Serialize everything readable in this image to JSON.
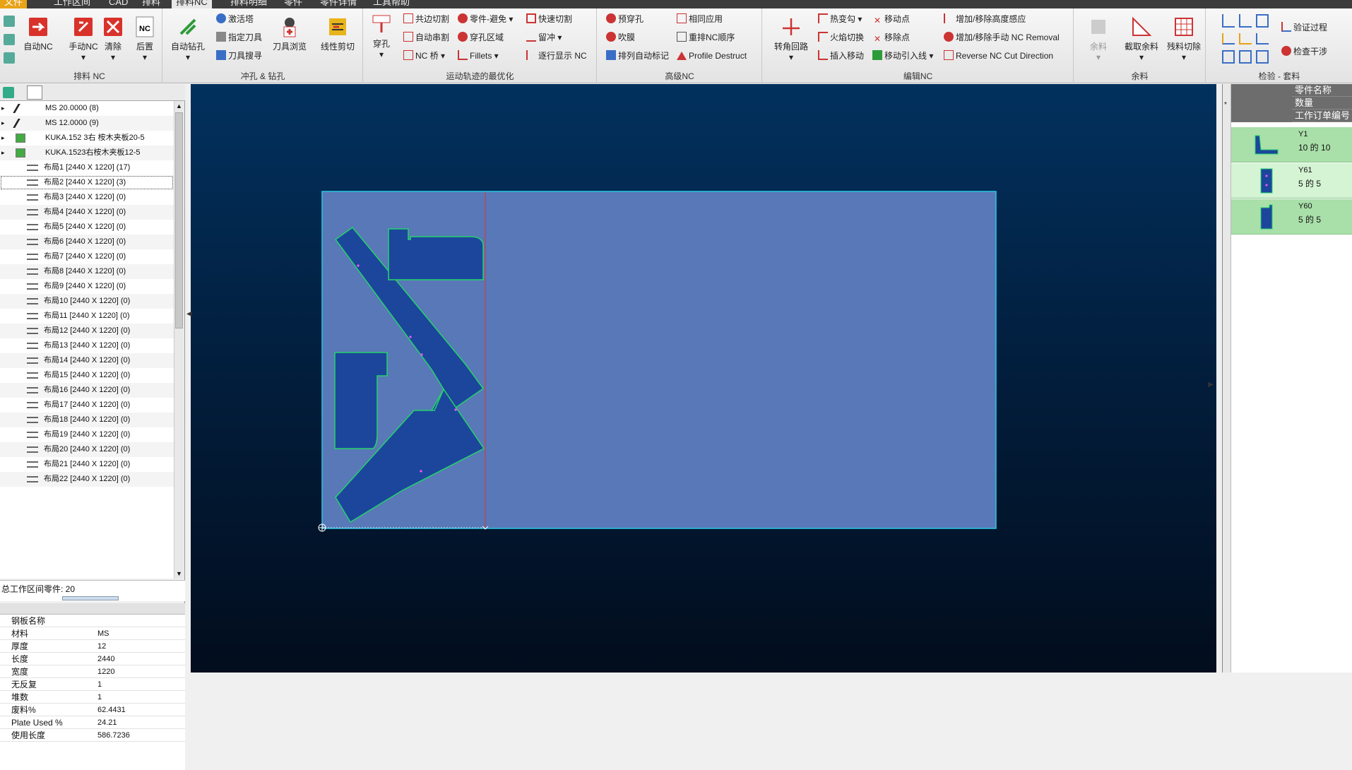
{
  "menu_tabs": [
    "文件",
    "工作区间",
    "CAD",
    "排料",
    "排料NC",
    "排料明细",
    "零件",
    "零件详情",
    "工具帮助"
  ],
  "ribbon": {
    "g1": {
      "label": "排料 NC",
      "auto_nc": "自动NC",
      "manual_nc": "手动NC",
      "clear": "清除",
      "post": "后置"
    },
    "g2": {
      "label": "冲孔 & 钻孔",
      "auto_drill": "自动钻孔",
      "activate": "激活塔",
      "set_tool": "指定刀具",
      "tool_search": "刀具搜寻",
      "tool_browse": "刀具浏览",
      "line_shear": "线性剪切"
    },
    "g3": {
      "label": "运动轨迹的最优化",
      "pierce": "穿孔",
      "common_cut": "共边切割",
      "auto_chain": "自动串割",
      "nc_bridge": "NC 桥",
      "part_avoid": "零件-避免",
      "pierce_area": "穿孔区域",
      "fillets": "Fillets",
      "quick_cut": "快速切割",
      "micro_joint": "留冲",
      "step_show": "逐行显示 NC"
    },
    "g4": {
      "label": "高级NC",
      "prepierce": "预穿孔",
      "blow": "吹膜",
      "auto_mark": "排列自动标记",
      "apply_same": "相同应用",
      "reorder": "重排NC顺序",
      "profile_destruct": "Profile Destruct"
    },
    "g5": {
      "label": "编辑NC",
      "corner_loop": "转角回路",
      "thermal": "热变勾",
      "flame": "火焰切换",
      "insert_move": "插入移动",
      "move_pt": "移动点",
      "remove_pt": "移除点",
      "move_lead": "移动引入线",
      "height_sense": "增加/移除高度感应",
      "manual_removal": "增加/移除手动 NC Removal",
      "reverse_dir": "Reverse NC Cut Direction"
    },
    "g6": {
      "label": "余料",
      "remnant": "余料",
      "cut_remnant": "截取余料",
      "scrap_cut": "残料切除"
    },
    "g7": {
      "label": "检验 - 套料",
      "verify": "验证过程",
      "check": "检查干涉"
    }
  },
  "tree": [
    {
      "label": "MS 20.0000 (8)",
      "lvl": 0
    },
    {
      "label": "MS 12.0000 (9)",
      "lvl": 0
    },
    {
      "label": "KUKA.152 3右 桉木夹板20-5",
      "lvl": 0
    },
    {
      "label": "KUKA.1523右桉木夹板12-5",
      "lvl": 0
    },
    {
      "label": "布局1 [2440 X 1220]  (17)",
      "lvl": 1
    },
    {
      "label": "布局2 [2440 X 1220]  (3)",
      "lvl": 1,
      "sel": true
    },
    {
      "label": "布局3 [2440 X 1220]  (0)",
      "lvl": 1
    },
    {
      "label": "布局4 [2440 X 1220]  (0)",
      "lvl": 1
    },
    {
      "label": "布局5 [2440 X 1220]  (0)",
      "lvl": 1
    },
    {
      "label": "布局6 [2440 X 1220]  (0)",
      "lvl": 1
    },
    {
      "label": "布局7 [2440 X 1220]  (0)",
      "lvl": 1
    },
    {
      "label": "布局8 [2440 X 1220]  (0)",
      "lvl": 1
    },
    {
      "label": "布局9 [2440 X 1220]  (0)",
      "lvl": 1
    },
    {
      "label": "布局10 [2440 X 1220]  (0)",
      "lvl": 1
    },
    {
      "label": "布局11 [2440 X 1220]  (0)",
      "lvl": 1
    },
    {
      "label": "布局12 [2440 X 1220]  (0)",
      "lvl": 1
    },
    {
      "label": "布局13 [2440 X 1220]  (0)",
      "lvl": 1
    },
    {
      "label": "布局14 [2440 X 1220]  (0)",
      "lvl": 1
    },
    {
      "label": "布局15 [2440 X 1220]  (0)",
      "lvl": 1
    },
    {
      "label": "布局16 [2440 X 1220]  (0)",
      "lvl": 1
    },
    {
      "label": "布局17 [2440 X 1220]  (0)",
      "lvl": 1
    },
    {
      "label": "布局18 [2440 X 1220]  (0)",
      "lvl": 1
    },
    {
      "label": "布局19 [2440 X 1220]  (0)",
      "lvl": 1
    },
    {
      "label": "布局20 [2440 X 1220]  (0)",
      "lvl": 1
    },
    {
      "label": "布局21 [2440 X 1220]  (0)",
      "lvl": 1
    },
    {
      "label": "布局22 [2440 X 1220]  (0)",
      "lvl": 1
    }
  ],
  "workspace_parts": "总工作区间零件: 20",
  "props": [
    {
      "k": "钢板名称",
      "v": ""
    },
    {
      "k": "材料",
      "v": "MS"
    },
    {
      "k": "厚度",
      "v": "12"
    },
    {
      "k": "长度",
      "v": "2440"
    },
    {
      "k": "宽度",
      "v": "1220"
    },
    {
      "k": "无反复",
      "v": "1"
    },
    {
      "k": "堆数",
      "v": "1"
    },
    {
      "k": "废料%",
      "v": "62.4431"
    },
    {
      "k": "Plate Used %",
      "v": "24.21"
    },
    {
      "k": "使用长度",
      "v": "586.7236"
    }
  ],
  "right_headers": [
    "零件名称",
    "数量",
    "工作订单编号"
  ],
  "parts": [
    {
      "name": "Y1",
      "qty": "10 的 10"
    },
    {
      "name": "Y61",
      "qty": "5 的 5"
    },
    {
      "name": "Y60",
      "qty": "5 的 5"
    }
  ],
  "colors": {
    "plate": "#5878b7",
    "part": "#1c469c",
    "outline": "#24d36c"
  }
}
